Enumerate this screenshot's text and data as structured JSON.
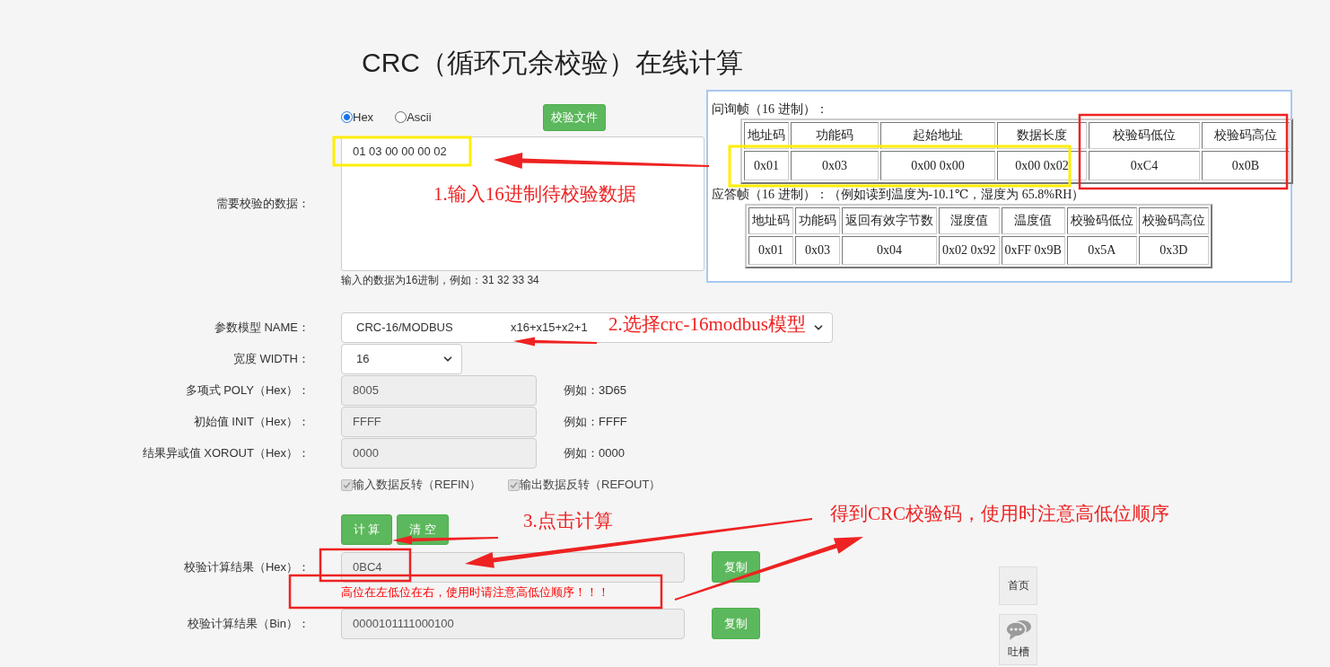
{
  "title": "CRC（循环冗余校验）在线计算",
  "input_mode": [
    {
      "label": "Hex",
      "selected": true
    },
    {
      "label": "Ascii",
      "selected": false
    }
  ],
  "file_button": "校验文件",
  "data_field": {
    "label": "需要校验的数据：",
    "value": "01 03 00 00 00 02",
    "hint": "输入的数据为16进制，例如：31 32 33 34"
  },
  "fields": [
    {
      "kind": "select",
      "label": "参数模型 NAME：",
      "value": "CRC-16/MODBUS",
      "formula": "x16+x15+x2+1"
    },
    {
      "kind": "select",
      "label": "宽度 WIDTH：",
      "value": "16"
    },
    {
      "kind": "text",
      "label": "多项式 POLY（Hex）：",
      "value": "8005",
      "example": "例如：3D65",
      "disabled": true
    },
    {
      "kind": "text",
      "label": "初始值 INIT（Hex）：",
      "value": "FFFF",
      "example": "例如：FFFF",
      "disabled": true
    },
    {
      "kind": "text",
      "label": "结果异或值 XOROUT（Hex）：",
      "value": "0000",
      "example": "例如：0000",
      "disabled": true
    }
  ],
  "reflect": [
    {
      "label": "输入数据反转（REFIN）",
      "checked": true,
      "disabled": true
    },
    {
      "label": "输出数据反转（REFOUT）",
      "checked": true,
      "disabled": true
    }
  ],
  "actions": [
    "计 算",
    "清 空"
  ],
  "results": [
    {
      "label": "校验计算结果（Hex）：",
      "value": "0BC4",
      "copy": "复制"
    },
    {
      "label": "校验计算结果（Bin）：",
      "value": "0000101111000100",
      "copy": "复制"
    }
  ],
  "warning": "高位在左低位在右，使用时请注意高低位顺序！！！",
  "side_buttons": [
    {
      "kind": "text",
      "label": "首页"
    },
    {
      "kind": "chat",
      "label": "吐槽"
    }
  ],
  "inset": {
    "query_title": "问询帧（16 进制）：",
    "query_header": [
      "地址码",
      "功能码",
      "起始地址",
      "数据长度",
      "校验码低位",
      "校验码高位"
    ],
    "query_row": [
      "0x01",
      "0x03",
      "0x00  0x00",
      "0x00  0x02",
      "0xC4",
      "0x0B"
    ],
    "reply_title": "应答帧（16 进制）：（例如读到温度为-10.1℃，湿度为 65.8%RH）",
    "reply_header": [
      "地址码",
      "功能码",
      "返回有效字节数",
      "湿度值",
      "温度值",
      "校验码低位",
      "校验码高位"
    ],
    "reply_row": [
      "0x01",
      "0x03",
      "0x04",
      "0x02 0x92",
      "0xFF 0x9B",
      "0x5A",
      "0x3D"
    ]
  },
  "annotations": [
    "1.输入16进制待校验数据",
    "2.选择crc-16modbus模型",
    "3.点击计算",
    "得到CRC校验码，使用时注意高低位顺序"
  ]
}
